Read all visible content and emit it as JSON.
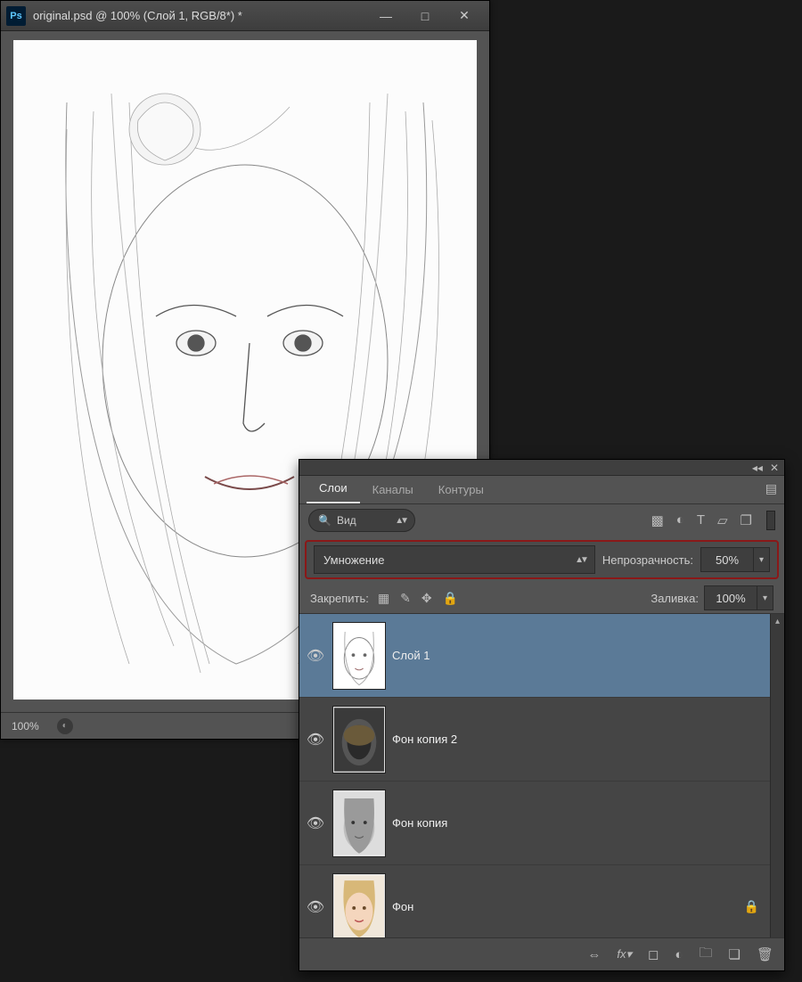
{
  "document": {
    "title": "original.psd @ 100% (Слой 1, RGB/8*) *",
    "zoom": "100%"
  },
  "window_controls": {
    "minimize": "—",
    "maximize": "□",
    "close": "✕"
  },
  "panel": {
    "tabs": {
      "layers": "Слои",
      "channels": "Каналы",
      "paths": "Контуры"
    },
    "search": {
      "icon": "🔍",
      "label": "Вид"
    },
    "filter_icons": [
      "image-icon",
      "adjust-icon",
      "type-icon",
      "crop-icon",
      "smart-icon"
    ],
    "blend_mode": "Умножение",
    "opacity_label": "Непрозрачность:",
    "opacity_value": "50%",
    "lock_label": "Закрепить:",
    "fill_label": "Заливка:",
    "fill_value": "100%",
    "layers": [
      {
        "name": "Слой 1",
        "selected": true,
        "thumb": "sketch",
        "locked": false
      },
      {
        "name": "Фон копия 2",
        "selected": false,
        "thumb": "blur",
        "locked": false
      },
      {
        "name": "Фон копия",
        "selected": false,
        "thumb": "bw",
        "locked": false
      },
      {
        "name": "Фон",
        "selected": false,
        "thumb": "color",
        "locked": true
      }
    ],
    "footer_icons": [
      "link-icon",
      "fx-icon",
      "mask-icon",
      "adjustment-icon",
      "group-icon",
      "new-layer-icon",
      "trash-icon"
    ]
  }
}
